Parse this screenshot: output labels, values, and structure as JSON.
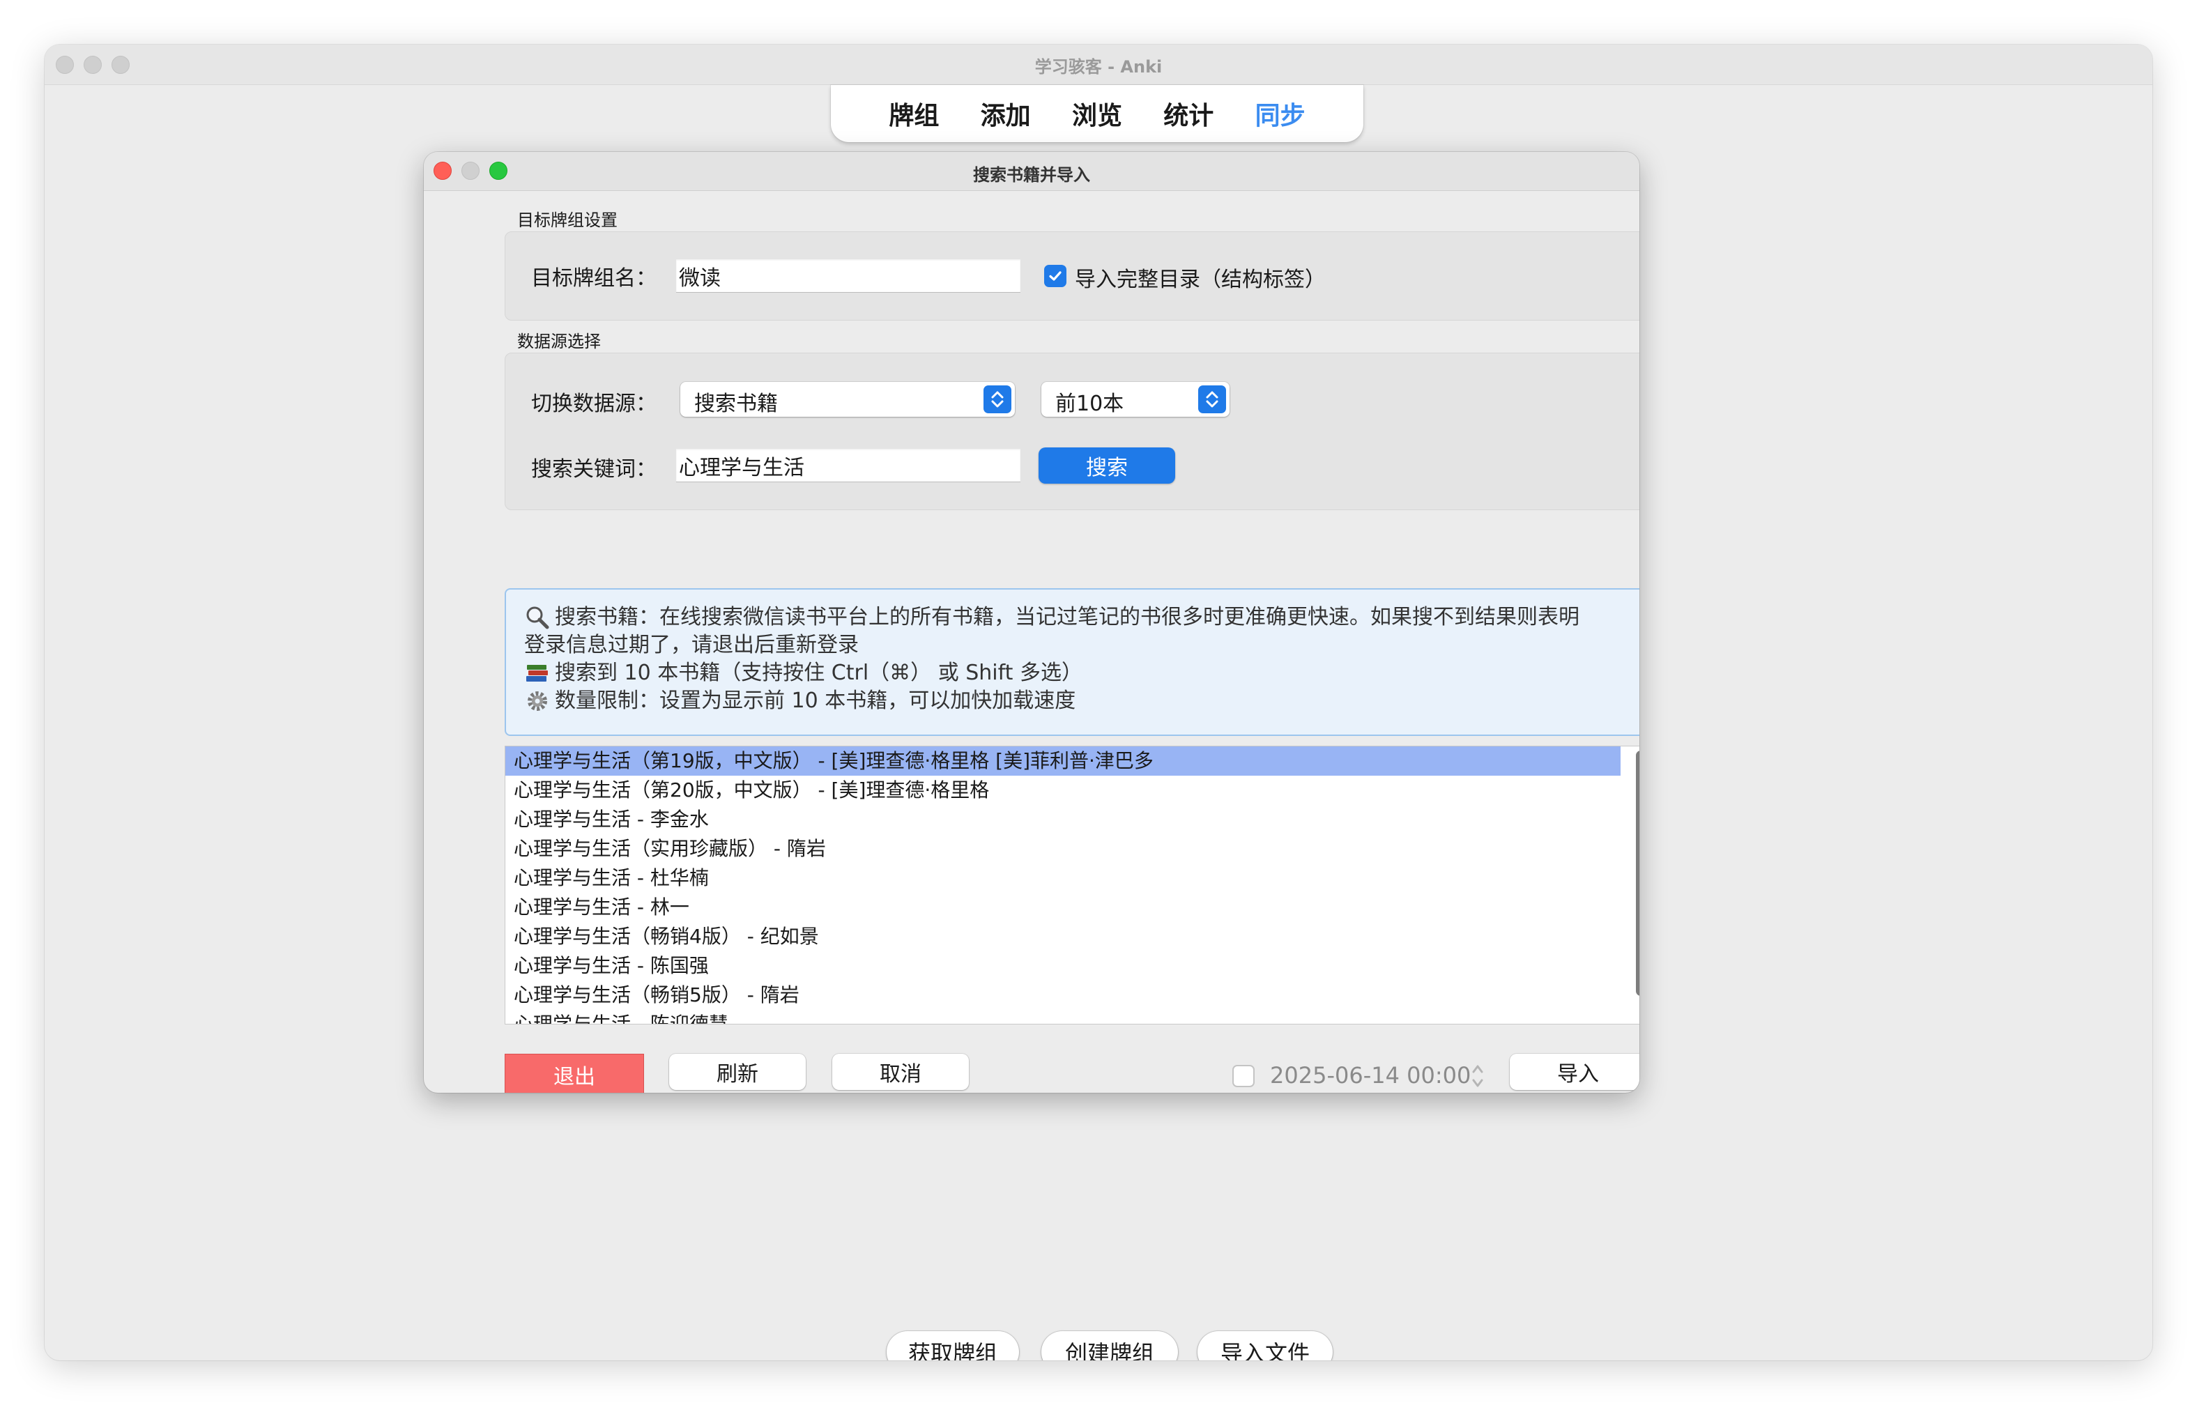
{
  "window": {
    "title": "学习骇客 - Anki"
  },
  "toolbar": {
    "items": [
      {
        "label": "牌组",
        "active": false
      },
      {
        "label": "添加",
        "active": false
      },
      {
        "label": "浏览",
        "active": false
      },
      {
        "label": "统计",
        "active": false
      },
      {
        "label": "同步",
        "active": true
      }
    ]
  },
  "dialog": {
    "title": "搜索书籍并导入",
    "target_section": {
      "title": "目标牌组设置",
      "deck_name_label": "目标牌组名：",
      "deck_name_value": "微读",
      "full_toc_checkbox": {
        "label": "导入完整目录（结构标签）",
        "checked": true
      }
    },
    "source_section": {
      "title": "数据源选择",
      "source_label": "切换数据源：",
      "source_value": "搜索书籍",
      "limit_value": "前10本",
      "keyword_label": "搜索关键词：",
      "keyword_value": "心理学与生活",
      "search_button": "搜索"
    },
    "info": {
      "line1": "搜索书籍：在线搜索微信读书平台上的所有书籍，当记过笔记的书很多时更准确更快速。如果搜不到结果则表明",
      "line1b": "登录信息过期了，请退出后重新登录",
      "line2": "搜索到 10 本书籍（支持按住 Ctrl（⌘） 或 Shift 多选）",
      "line3": "数量限制：设置为显示前 10 本书籍，可以加快加载速度",
      "icons": [
        "magnifier-icon",
        "books-icon",
        "gear-icon"
      ]
    },
    "results": [
      "心理学与生活（第19版，中文版） - [美]理查德·格里格 [美]菲利普·津巴多",
      "心理学与生活（第20版，中文版） - [美]理查德·格里格",
      "心理学与生活 - 李金水",
      "心理学与生活（实用珍藏版） - 隋岩",
      "心理学与生活 - 杜华楠",
      "心理学与生活 - 林一",
      "心理学与生活（畅销4版） - 纪如景",
      "心理学与生活 - 陈国强",
      "心理学与生活（畅销5版） - 隋岩",
      "心理学与生活 - 陈迎德慧"
    ],
    "selected_index": 0,
    "buttons": {
      "quit": "退出",
      "refresh": "刷新",
      "cancel": "取消",
      "import": "导入"
    },
    "date_checkbox_checked": false,
    "datetime_value": "2025-06-14 00:00"
  },
  "bottom_buttons": {
    "get_decks": "获取牌组",
    "create_deck": "创建牌组",
    "import_file": "导入文件"
  },
  "colors": {
    "accent": "#1f7ae8",
    "active_tab": "#3b8cf0",
    "danger": "#f86a6a",
    "selection": "#98b4f4",
    "info_bg": "#e9f2fb"
  }
}
